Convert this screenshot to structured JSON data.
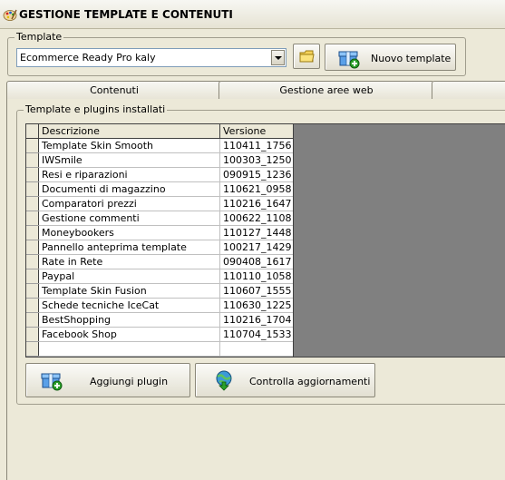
{
  "window": {
    "title": "GESTIONE TEMPLATE E CONTENUTI"
  },
  "template_group": {
    "legend": "Template",
    "combo_value": "Ecommerce Ready Pro kaly",
    "new_button_label": "Nuovo template"
  },
  "tabs": [
    {
      "label": "Contenuti"
    },
    {
      "label": "Gestione aree web"
    },
    {
      "label": ""
    }
  ],
  "plugins_group": {
    "legend": "Template e plugins installati",
    "columns": [
      "Descrizione",
      "Versione"
    ],
    "rows": [
      {
        "descrizione": "Template Skin Smooth",
        "versione": "110411_1756"
      },
      {
        "descrizione": "IWSmile",
        "versione": "100303_1250"
      },
      {
        "descrizione": "Resi e riparazioni",
        "versione": "090915_1236"
      },
      {
        "descrizione": "Documenti di magazzino",
        "versione": "110621_0958"
      },
      {
        "descrizione": "Comparatori prezzi",
        "versione": "110216_1647"
      },
      {
        "descrizione": "Gestione commenti",
        "versione": "100622_1108"
      },
      {
        "descrizione": "Moneybookers",
        "versione": "110127_1448"
      },
      {
        "descrizione": "Pannello anteprima template",
        "versione": "100217_1429"
      },
      {
        "descrizione": "Rate in Rete",
        "versione": "090408_1617"
      },
      {
        "descrizione": "Paypal",
        "versione": "110110_1058"
      },
      {
        "descrizione": "Template Skin Fusion",
        "versione": "110607_1555"
      },
      {
        "descrizione": "Schede tecniche IceCat",
        "versione": "110630_1225"
      },
      {
        "descrizione": "BestShopping",
        "versione": "110216_1704"
      },
      {
        "descrizione": "Facebook Shop",
        "versione": "110704_1533"
      },
      {
        "descrizione": "",
        "versione": ""
      }
    ]
  },
  "actions": {
    "add_plugin_label": "Aggiungi plugin",
    "check_updates_label": "Controlla aggiornamenti"
  },
  "icons": {
    "title": "palette-icon",
    "folder": "folder-icon",
    "new_template": "gift-box-add-icon",
    "add_plugin": "gift-box-add-icon",
    "check_updates": "globe-download-icon"
  }
}
